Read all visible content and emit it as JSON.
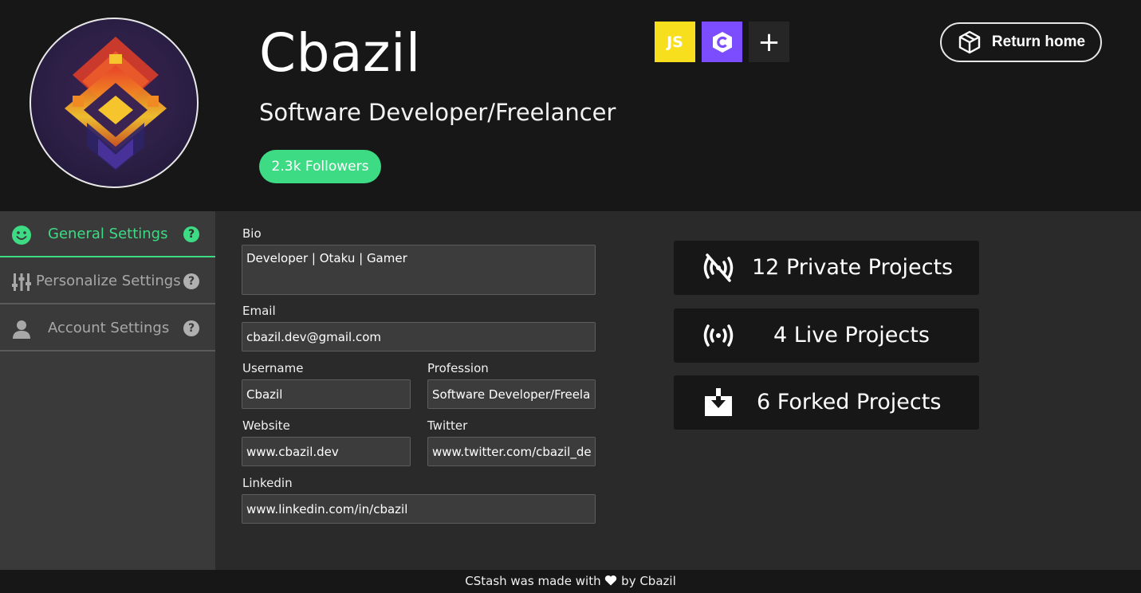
{
  "profile": {
    "name": "Cbazil",
    "profession": "Software Developer/Freelancer",
    "followers": "2.3k Followers"
  },
  "languages": [
    {
      "label": "JS",
      "color": "#f7df1e"
    },
    {
      "label": "C#",
      "color": "#7c4dff"
    }
  ],
  "add_language_label": "+",
  "return_home": "Return home",
  "sidebar": {
    "items": [
      {
        "label": "General Settings",
        "icon": "smiley-icon",
        "help": "?"
      },
      {
        "label": "Personalize Settings",
        "icon": "sliders-icon",
        "help": "?"
      },
      {
        "label": "Account Settings",
        "icon": "user-icon",
        "help": "?"
      }
    ]
  },
  "form": {
    "bio_label": "Bio",
    "bio_value": "Developer | Otaku | Gamer",
    "email_label": "Email",
    "email_value": "cbazil.dev@gmail.com",
    "username_label": "Username",
    "username_value": "Cbazil",
    "profession_label": "Profession",
    "profession_value": "Software Developer/Freelancer",
    "website_label": "Website",
    "website_value": "www.cbazil.dev",
    "twitter_label": "Twitter",
    "twitter_value": "www.twitter.com/cbazil_dev",
    "linkedin_label": "Linkedin",
    "linkedin_value": "www.linkedin.com/in/cbazil"
  },
  "stats": [
    {
      "label": "12 Private Projects",
      "icon": "broadcast-off-icon"
    },
    {
      "label": "4 Live Projects",
      "icon": "broadcast-icon"
    },
    {
      "label": "6 Forked Projects",
      "icon": "download-box-icon"
    }
  ],
  "footer": {
    "before": "CStash was made with",
    "after": "by Cbazil"
  },
  "colors": {
    "accent": "#3ddc84",
    "header_bg": "#171717",
    "sidebar_bg": "#3a3a3a",
    "main_bg": "#2a2a2a"
  }
}
